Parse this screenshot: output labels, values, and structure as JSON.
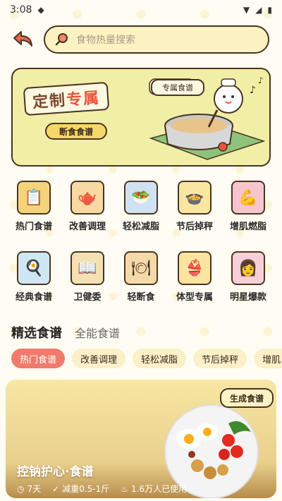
{
  "status": {
    "time": "3:08"
  },
  "search": {
    "placeholder": "食物热量搜索"
  },
  "banner": {
    "title_part1": "定制",
    "title_part2": "专属",
    "button_label": "断食食谱",
    "tag_label": "专属食谱"
  },
  "categories": [
    {
      "label": "热门食谱",
      "icon": "popular-recipes-icon",
      "color": "#f4d37a"
    },
    {
      "label": "改善调理",
      "icon": "teapot-icon",
      "color": "#f7d9a3"
    },
    {
      "label": "轻松减脂",
      "icon": "salad-icon",
      "color": "#cfe2f3"
    },
    {
      "label": "节后掉秤",
      "icon": "bowl-icon",
      "color": "#f9e6a0"
    },
    {
      "label": "增肌燃脂",
      "icon": "muscle-chicken-icon",
      "color": "#f6c6cf"
    },
    {
      "label": "经典食谱",
      "icon": "breakfast-icon",
      "color": "#cfe6f5"
    },
    {
      "label": "卫健委",
      "icon": "book-icon",
      "color": "#f3e1b4"
    },
    {
      "label": "轻断食",
      "icon": "plate-icon",
      "color": "#f6d9a8"
    },
    {
      "label": "体型专属",
      "icon": "body-icon",
      "color": "#fbe3a0"
    },
    {
      "label": "明星爆款",
      "icon": "star-girl-icon",
      "color": "#f8cfd6"
    }
  ],
  "sections": {
    "active": "精选食谱",
    "inactive": "全能食谱"
  },
  "chips": [
    "热门食谱",
    "改善调理",
    "轻松减脂",
    "节后掉秤",
    "增肌"
  ],
  "card": {
    "title": "控钠护心·食谱",
    "duration": "7天",
    "goal": "减重0.5-1斤",
    "users": "1.6万人已使用",
    "generate_label": "生成食谱"
  }
}
